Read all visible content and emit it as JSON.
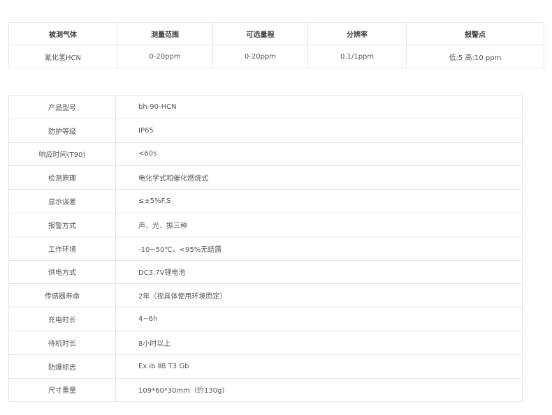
{
  "gas_table": {
    "headers": [
      "被测气体",
      "测量范围",
      "可选量程",
      "分辨率",
      "报警点"
    ],
    "row": [
      "氰化氢HCN",
      "0-20ppm",
      "0-20ppm",
      "0.1/1ppm",
      "低:5 高:10 ppm"
    ]
  },
  "spec_table": {
    "rows": [
      {
        "key": "产品型号",
        "value": "bh-90-HCN"
      },
      {
        "key": "防护等级",
        "value": "IP65"
      },
      {
        "key": "响应时间(T90)",
        "value": "<60s"
      },
      {
        "key": "检测原理",
        "value": "电化学式和催化燃烧式"
      },
      {
        "key": "显示误差",
        "value": "≤±5%F.S"
      },
      {
        "key": "报警方式",
        "value": "声、光、振三种"
      },
      {
        "key": "工作环境",
        "value": "-10~50℃、<95%无结露"
      },
      {
        "key": "供电方式",
        "value": "DC3.7V锂电池"
      },
      {
        "key": "传感器寿命",
        "value": "2年（视具体使用环境而定）"
      },
      {
        "key": "充电时长",
        "value": "4~6h"
      },
      {
        "key": "待机时长",
        "value": "8小时以上"
      },
      {
        "key": "防爆标志",
        "value": "Ex ib ⅡB T3 Gb"
      },
      {
        "key": "尺寸重量",
        "value": "109*60*30mm（约130g)"
      }
    ]
  }
}
